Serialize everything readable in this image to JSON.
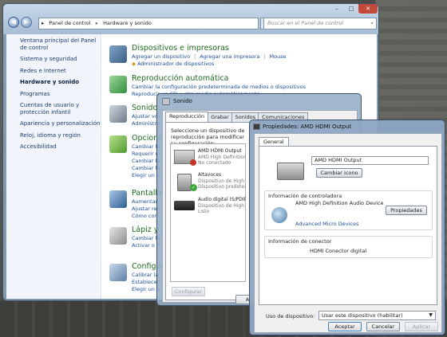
{
  "control_panel": {
    "address": [
      "Panel de control",
      "Hardware y sonido"
    ],
    "search_placeholder": "Buscar en el Panel de control",
    "sidebar": [
      "Ventana principal del Panel de control",
      "Sistema y seguridad",
      "Redes e Internet",
      "Hardware y sonido",
      "Programas",
      "Cuentas de usuario y protección infantil",
      "Apariencia y personalización",
      "Reloj, idioma y región",
      "Accesibilidad"
    ],
    "categories": [
      {
        "title": "Dispositivos e impresoras",
        "links": [
          [
            "Agregar un dispositivo",
            "Agregar una impresora",
            "Mouse"
          ],
          [
            "Administrador de dispositivos"
          ]
        ]
      },
      {
        "title": "Reproducción automática",
        "links": [
          [
            "Cambiar la configuración predeterminada de medios o dispositivos"
          ],
          [
            "Reproducir un CD u otro medio automáticamente"
          ]
        ]
      },
      {
        "title": "Sonido",
        "links": [
          [
            "Ajustar vol"
          ],
          [
            "Administra"
          ]
        ]
      },
      {
        "title": "Opciones",
        "links": [
          [
            "Cambiar la"
          ],
          [
            "Requerir u"
          ],
          [
            "Cambiar la"
          ],
          [
            "Cambiar la"
          ],
          [
            "Elegir un p"
          ]
        ]
      },
      {
        "title": "Pantalla",
        "links": [
          [
            "Aumentar"
          ],
          [
            "Ajustar res"
          ],
          [
            "Cómo corr"
          ]
        ]
      },
      {
        "title": "Lápiz y d",
        "links": [
          [
            "Cambiar la"
          ],
          [
            "Activar o d"
          ]
        ]
      },
      {
        "title": "Configura",
        "links": [
          [
            "Calibrar la"
          ],
          [
            "Establecer"
          ],
          [
            "Elegir un p"
          ]
        ]
      }
    ]
  },
  "sound_dialog": {
    "title": "Sonido",
    "tabs": [
      "Reproducción",
      "Grabar",
      "Sonidos",
      "Comunicaciones"
    ],
    "selected_tab": "Reproducción",
    "description": "Seleccione un dispositivo de reproducción para modificar su configuración:",
    "devices": [
      {
        "name": "AMD HDMI Output",
        "line2": "AMD High Definition",
        "line3": "No conectado"
      },
      {
        "name": "Altavoces",
        "line2": "Dispositivo de High",
        "line3": "Dispositivo predeter"
      },
      {
        "name": "Audio digital (S/PDIF)",
        "line2": "Dispositivo de High",
        "line3": "Listo"
      }
    ],
    "configure_button": "Configurar",
    "ok_button_partial": "A"
  },
  "properties_dialog": {
    "title": "Propiedades: AMD HDMI Output",
    "tab": "General",
    "device_name": "AMD HDMI Output",
    "change_icon_button": "Cambiar icono",
    "controller_group_title": "Información de controladora",
    "controller_name": "AMD High Definition Audio Device",
    "properties_button": "Propiedades",
    "manufacturer": "Advanced Micro Devices",
    "connector_group_title": "Información de conector",
    "connector_name": "HDMI Conector digital",
    "usage_label": "Uso de dispositivo:",
    "usage_value": "Usar este dispositivo (habilitar)",
    "ok_button": "Aceptar",
    "cancel_button": "Cancelar",
    "apply_button": "Aplicar"
  },
  "colors": {
    "link": "#1a4f9c",
    "category_title": "#1e6a1e",
    "close_button": "#c34a3a"
  }
}
